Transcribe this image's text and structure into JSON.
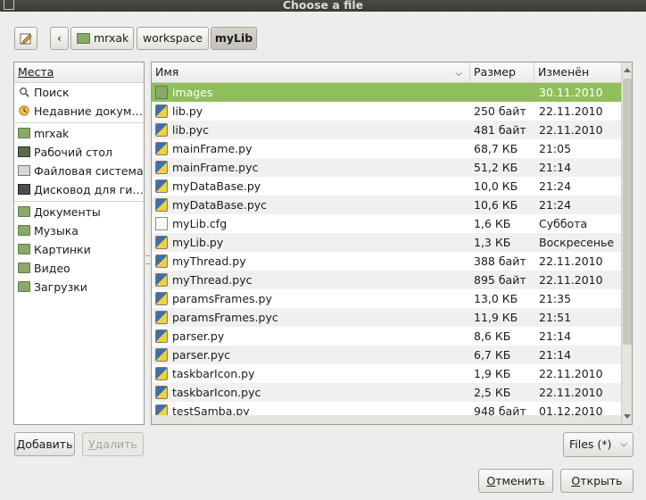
{
  "window": {
    "title": "Choose a file"
  },
  "path": {
    "back_symbol": "‹",
    "segments": [
      {
        "label": "mrxak"
      },
      {
        "label": "workspace"
      },
      {
        "label": "myLib"
      }
    ]
  },
  "sidebar": {
    "header": "Места",
    "group1": [
      {
        "label": "Поиск",
        "icon": "search-icon"
      },
      {
        "label": "Недавние докум…",
        "icon": "recent-icon"
      }
    ],
    "group2": [
      {
        "label": "mrxak",
        "icon": "home-folder-icon"
      },
      {
        "label": "Рабочий стол",
        "icon": "desktop-icon"
      },
      {
        "label": "Файловая система",
        "icon": "filesystem-icon"
      },
      {
        "label": "Дисковод для ги…",
        "icon": "floppy-icon"
      }
    ],
    "group3": [
      {
        "label": "Документы",
        "icon": "folder-icon"
      },
      {
        "label": "Музыка",
        "icon": "folder-icon"
      },
      {
        "label": "Картинки",
        "icon": "folder-icon"
      },
      {
        "label": "Видео",
        "icon": "folder-icon"
      },
      {
        "label": "Загрузки",
        "icon": "folder-icon"
      }
    ]
  },
  "filelist": {
    "columns": {
      "name": "Имя",
      "size": "Размер",
      "modified": "Изменён"
    },
    "rows": [
      {
        "name": "images",
        "size": "",
        "date": "30.11.2010",
        "type": "folder",
        "selected": true
      },
      {
        "name": "lib.py",
        "size": "250 байт",
        "date": "22.11.2010",
        "type": "py"
      },
      {
        "name": "lib.pyc",
        "size": "481 байт",
        "date": "22.11.2010",
        "type": "py"
      },
      {
        "name": "mainFrame.py",
        "size": "68,7 КБ",
        "date": "21:05",
        "type": "py"
      },
      {
        "name": "mainFrame.pyc",
        "size": "51,2 КБ",
        "date": "21:14",
        "type": "py"
      },
      {
        "name": "myDataBase.py",
        "size": "10,0 КБ",
        "date": "21:24",
        "type": "py"
      },
      {
        "name": "myDataBase.pyc",
        "size": "10,6 КБ",
        "date": "21:24",
        "type": "py"
      },
      {
        "name": "myLib.cfg",
        "size": "1,6 КБ",
        "date": "Суббота",
        "type": "cfg"
      },
      {
        "name": "myLib.py",
        "size": "1,3 КБ",
        "date": "Воскресенье",
        "type": "py"
      },
      {
        "name": "myThread.py",
        "size": "388 байт",
        "date": "22.11.2010",
        "type": "py"
      },
      {
        "name": "myThread.pyc",
        "size": "895 байт",
        "date": "22.11.2010",
        "type": "py"
      },
      {
        "name": "paramsFrames.py",
        "size": "13,0 КБ",
        "date": "21:35",
        "type": "py"
      },
      {
        "name": "paramsFrames.pyc",
        "size": "11,9 КБ",
        "date": "21:51",
        "type": "py"
      },
      {
        "name": "parser.py",
        "size": "8,6 КБ",
        "date": "21:14",
        "type": "py"
      },
      {
        "name": "parser.pyc",
        "size": "6,7 КБ",
        "date": "21:14",
        "type": "py"
      },
      {
        "name": "taskbarIcon.py",
        "size": "1,9 КБ",
        "date": "22.11.2010",
        "type": "py"
      },
      {
        "name": "taskbarIcon.pyc",
        "size": "2,5 КБ",
        "date": "22.11.2010",
        "type": "py"
      },
      {
        "name": "testSamba.py",
        "size": "948 байт",
        "date": "01.12.2010",
        "type": "py"
      }
    ]
  },
  "buttons": {
    "add_first": "Д",
    "add_rest": "обавить",
    "remove_first": "У",
    "remove_rest": "далить",
    "filter": "Files (*)",
    "cancel_first": "О",
    "cancel_rest": "тменить",
    "open_first": "О",
    "open_rest": "ткрыть"
  },
  "colors": {
    "selection": "#8fbf5a",
    "titlebar": "#3c3b37"
  }
}
